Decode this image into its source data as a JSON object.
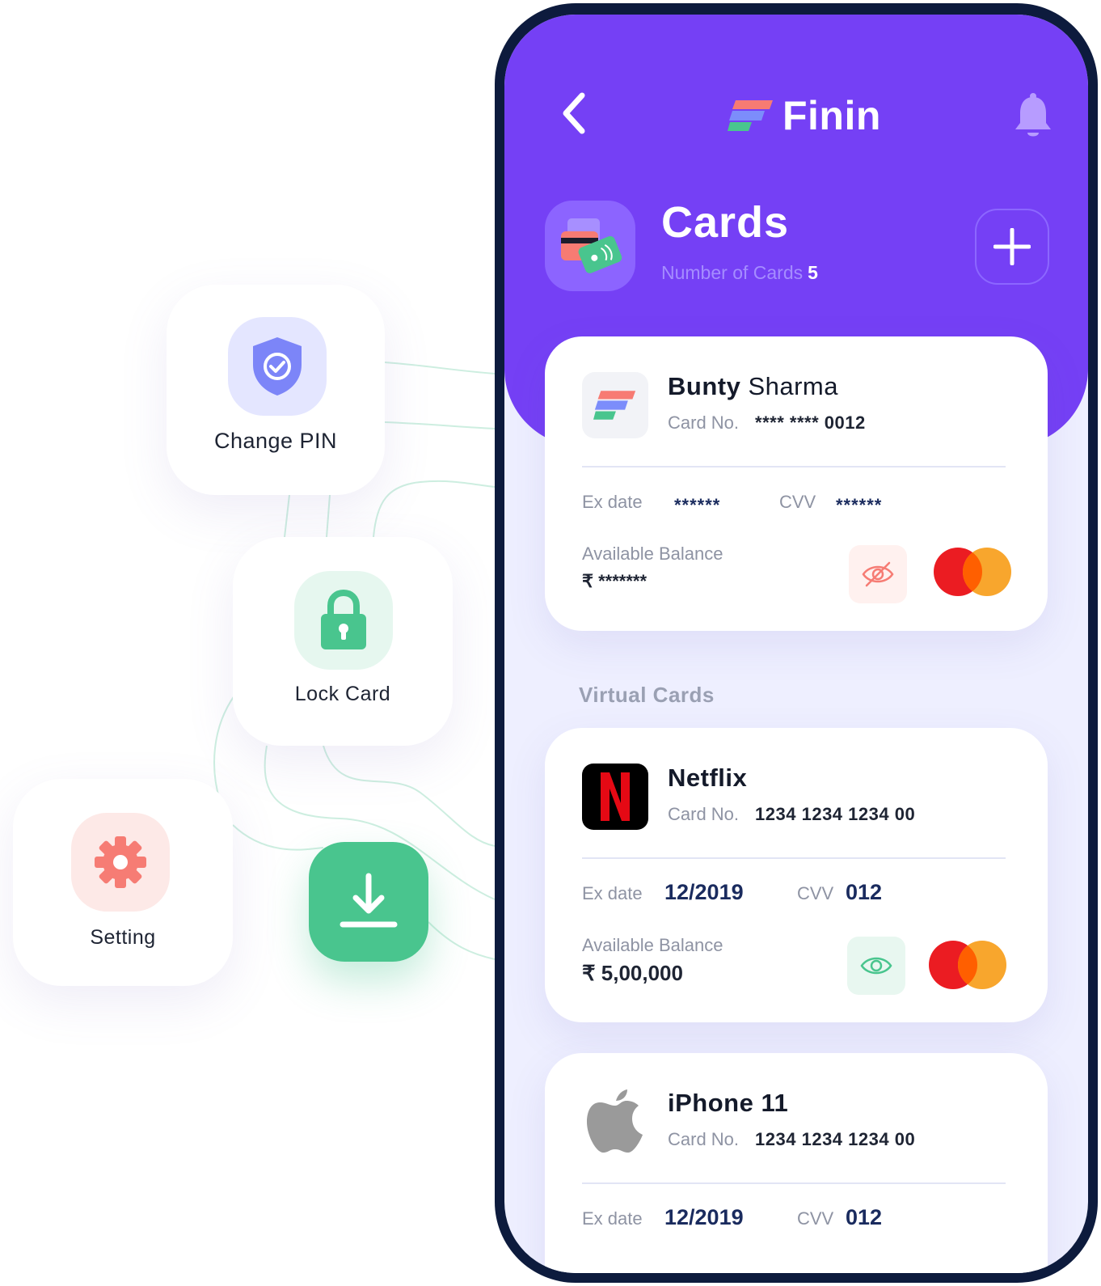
{
  "app": {
    "name": "Finin"
  },
  "features": {
    "change_pin_label": "Change PIN",
    "lock_card_label": "Lock Card",
    "setting_label": "Setting"
  },
  "header": {
    "title": "Cards",
    "count_label": "Number of Cards",
    "count_value": "5"
  },
  "main_card": {
    "first_name": "Bunty",
    "last_name": "Sharma",
    "card_no_label": "Card No.",
    "card_no": "**** **** 0012",
    "ex_date_label": "Ex date",
    "ex_date": "******",
    "cvv_label": "CVV",
    "cvv": "******",
    "balance_label": "Available Balance",
    "balance": "₹ *******"
  },
  "virtual_section": {
    "title": "Virtual Cards"
  },
  "virtual_cards": [
    {
      "name": "Netflix",
      "card_no_label": "Card No.",
      "card_no": "1234 1234 1234 00",
      "ex_date_label": "Ex date",
      "ex_date": "12/2019",
      "cvv_label": "CVV",
      "cvv": "012",
      "balance_label": "Available Balance",
      "balance": "₹ 5,00,000"
    },
    {
      "name": "iPhone 11",
      "card_no_label": "Card No.",
      "card_no": "1234 1234 1234 00",
      "ex_date_label": "Ex date",
      "ex_date": "12/2019",
      "cvv_label": "CVV",
      "cvv": "012"
    }
  ],
  "icons": {
    "change_pin": "shield-check-icon",
    "lock_card": "lock-icon",
    "setting": "gear-icon",
    "download": "download-icon",
    "back": "chevron-left-icon",
    "bell": "bell-icon",
    "add": "plus-icon",
    "hide_balance": "eye-off-icon",
    "show_balance": "eye-icon",
    "network": "mastercard-icon"
  },
  "colors": {
    "primary": "#7540F5",
    "green": "#49C58E",
    "pink": "#F67C74",
    "dark": "#0D1B3D",
    "shield": "#7C85F8"
  }
}
